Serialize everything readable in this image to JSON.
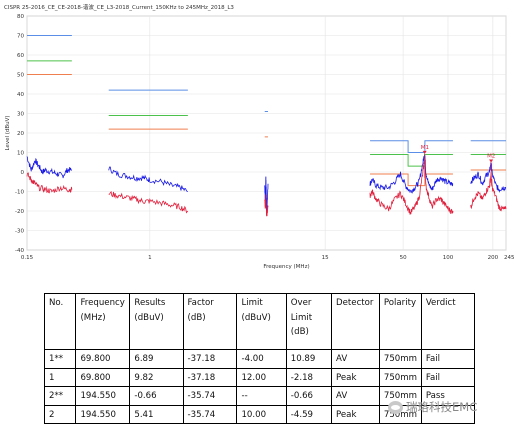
{
  "chart_data": {
    "type": "line",
    "title": "CISPR 25-2016_CE_CE-2018-谐波_CE_L3-2018_Current_150KHz to 245MHz_2018_L3",
    "xlabel": "Frequency (MHz)",
    "ylabel": "Level (dBuV)",
    "x_scale": "log",
    "xlim": [
      0.15,
      245
    ],
    "ylim": [
      -40,
      80
    ],
    "y_ticks": [
      "80",
      "70",
      "60",
      "50",
      "40",
      "30",
      "20",
      "10",
      "0",
      "-10",
      "-20",
      "-30",
      "-40"
    ],
    "x_ticks": [
      "0.15",
      "1",
      "15",
      "50",
      "100",
      "200",
      "245"
    ],
    "grid": true,
    "colors": {
      "peak": "#1a1ae6",
      "average": "#e0203c",
      "limit_peak": "#5b8ee6",
      "limit_qp": "#4cc24c",
      "limit_avg": "#f07f4f",
      "marker": "#e0203c"
    },
    "limit_lines": [
      {
        "color_key": "limit_peak",
        "segments": [
          [
            0.15,
            0.3,
            70
          ],
          [
            0.53,
            1.8,
            42
          ],
          [
            5.9,
            6.2,
            31
          ],
          [
            30,
            54,
            16
          ],
          [
            54,
            70,
            10
          ],
          [
            70,
            108,
            16
          ],
          [
            142,
            245,
            16
          ]
        ]
      },
      {
        "color_key": "limit_qp",
        "segments": [
          [
            0.15,
            0.3,
            57
          ],
          [
            0.53,
            1.8,
            29
          ],
          [
            30,
            54,
            9
          ],
          [
            54,
            70,
            3
          ],
          [
            70,
            108,
            9
          ],
          [
            142,
            245,
            9
          ]
        ]
      },
      {
        "color_key": "limit_avg",
        "segments": [
          [
            0.15,
            0.3,
            50
          ],
          [
            0.53,
            1.8,
            22
          ],
          [
            5.9,
            6.2,
            18
          ],
          [
            30,
            54,
            -1
          ],
          [
            54,
            70,
            -7
          ],
          [
            70,
            108,
            -1
          ],
          [
            142,
            245,
            1
          ]
        ]
      }
    ],
    "series": [
      {
        "color_key": "peak",
        "band_segments": [
          [
            [
              0.15,
              8
            ],
            [
              0.16,
              1
            ],
            [
              0.17,
              6
            ],
            [
              0.18,
              3
            ],
            [
              0.19,
              0
            ],
            [
              0.2,
              1
            ],
            [
              0.22,
              0
            ],
            [
              0.24,
              -1
            ],
            [
              0.26,
              -2
            ],
            [
              0.28,
              1
            ],
            [
              0.3,
              1
            ]
          ],
          [
            [
              0.53,
              2
            ],
            [
              0.6,
              -1
            ],
            [
              0.7,
              -2
            ],
            [
              0.8,
              -3
            ],
            [
              0.9,
              -3
            ],
            [
              1.0,
              -4
            ],
            [
              1.2,
              -5
            ],
            [
              1.4,
              -7
            ],
            [
              1.6,
              -8
            ],
            [
              1.8,
              -10
            ]
          ],
          [
            [
              5.9,
              -8
            ],
            [
              5.95,
              -15
            ],
            [
              6.0,
              -2
            ],
            [
              6.05,
              -13
            ],
            [
              6.1,
              -20
            ],
            [
              6.2,
              -6
            ]
          ],
          [
            [
              30,
              -6
            ],
            [
              31,
              -4
            ],
            [
              33,
              -7
            ],
            [
              36,
              -8
            ],
            [
              40,
              -8
            ],
            [
              44,
              -5
            ],
            [
              48,
              -1
            ],
            [
              52,
              -7
            ],
            [
              56,
              -10
            ],
            [
              60,
              -8
            ],
            [
              64,
              -5
            ],
            [
              68,
              5
            ],
            [
              69.8,
              10
            ],
            [
              71,
              0
            ],
            [
              74,
              -6
            ],
            [
              78,
              -9
            ],
            [
              84,
              -4
            ],
            [
              90,
              -3
            ],
            [
              96,
              -5
            ],
            [
              104,
              -6
            ],
            [
              108,
              -6
            ]
          ],
          [
            [
              142,
              -5
            ],
            [
              150,
              -3
            ],
            [
              160,
              -1
            ],
            [
              170,
              -6
            ],
            [
              180,
              -2
            ],
            [
              190,
              0
            ],
            [
              194.55,
              5
            ],
            [
              198,
              -1
            ],
            [
              210,
              -7
            ],
            [
              220,
              -9
            ],
            [
              232,
              -8
            ],
            [
              245,
              -8
            ]
          ]
        ]
      },
      {
        "color_key": "average",
        "band_segments": [
          [
            [
              0.15,
              -1
            ],
            [
              0.16,
              -4
            ],
            [
              0.17,
              -6
            ],
            [
              0.18,
              -8
            ],
            [
              0.2,
              -9
            ],
            [
              0.22,
              -10
            ],
            [
              0.25,
              -8
            ],
            [
              0.28,
              -9
            ],
            [
              0.3,
              -9
            ]
          ],
          [
            [
              0.53,
              -11
            ],
            [
              0.6,
              -12
            ],
            [
              0.7,
              -13
            ],
            [
              0.8,
              -14
            ],
            [
              0.9,
              -15
            ],
            [
              1.0,
              -15
            ],
            [
              1.2,
              -16
            ],
            [
              1.4,
              -17
            ],
            [
              1.6,
              -18
            ],
            [
              1.8,
              -20
            ]
          ],
          [
            [
              5.9,
              -14
            ],
            [
              5.95,
              -19
            ],
            [
              6.0,
              -12
            ],
            [
              6.05,
              -21
            ],
            [
              6.1,
              -22
            ],
            [
              6.2,
              -18
            ]
          ],
          [
            [
              30,
              -12
            ],
            [
              31,
              -10
            ],
            [
              33,
              -14
            ],
            [
              36,
              -17
            ],
            [
              40,
              -19
            ],
            [
              44,
              -14
            ],
            [
              48,
              -11
            ],
            [
              52,
              -16
            ],
            [
              56,
              -21
            ],
            [
              60,
              -18
            ],
            [
              64,
              -13
            ],
            [
              68,
              0
            ],
            [
              69.8,
              7
            ],
            [
              71,
              -7
            ],
            [
              74,
              -12
            ],
            [
              78,
              -18
            ],
            [
              84,
              -14
            ],
            [
              90,
              -14
            ],
            [
              96,
              -17
            ],
            [
              104,
              -20
            ],
            [
              108,
              -20
            ]
          ],
          [
            [
              142,
              -18
            ],
            [
              150,
              -13
            ],
            [
              160,
              -11
            ],
            [
              170,
              -14
            ],
            [
              180,
              -10
            ],
            [
              190,
              -7
            ],
            [
              194.55,
              -1
            ],
            [
              198,
              -8
            ],
            [
              210,
              -13
            ],
            [
              220,
              -18
            ],
            [
              232,
              -19
            ],
            [
              245,
              -19
            ]
          ]
        ]
      }
    ],
    "markers": [
      {
        "label": "M1",
        "x": 69.8,
        "y": 9.82
      },
      {
        "label": "M2",
        "x": 194.55,
        "y": 5.41
      }
    ]
  },
  "table": {
    "headers": [
      "No.",
      "Frequency (MHz)",
      "Results (dBuV)",
      "Factor (dB)",
      "Limit (dBuV)",
      "Over Limit (dB)",
      "Detector",
      "Polarity",
      "Verdict"
    ],
    "rows": [
      [
        "1**",
        "69.800",
        "6.89",
        "-37.18",
        "-4.00",
        "10.89",
        "AV",
        "750mm",
        "Fail"
      ],
      [
        "1",
        "69.800",
        "9.82",
        "-37.18",
        "12.00",
        "-2.18",
        "Peak",
        "750mm",
        "Fail"
      ],
      [
        "2**",
        "194.550",
        "-0.66",
        "-35.74",
        "--",
        "-0.66",
        "AV",
        "750mm",
        "Pass"
      ],
      [
        "2",
        "194.550",
        "5.41",
        "-35.74",
        "10.00",
        "-4.59",
        "Peak",
        "750mm",
        ""
      ]
    ]
  },
  "watermark": "瑞珞科技EMC"
}
